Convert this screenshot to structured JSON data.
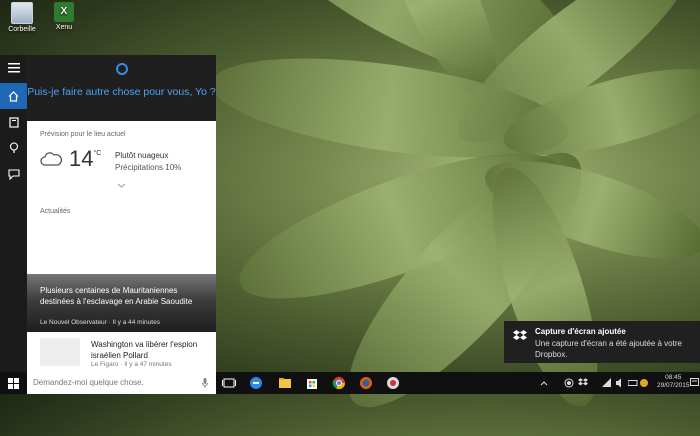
{
  "desktop": {
    "icons": [
      {
        "label": "Corbeille",
        "icon": "recycle-bin-icon"
      },
      {
        "label": "Xenu",
        "icon": "xenu-app-icon"
      }
    ]
  },
  "cortana": {
    "prompt": "Puis-je faire autre chose pour vous, Yo ?",
    "nav": [
      "hamburger-icon",
      "home-icon",
      "notebook-icon",
      "lightbulb-icon",
      "feedback-icon"
    ],
    "weather": {
      "label": "Prévision pour le lieu actuel",
      "temp": "14",
      "unit": "°C",
      "condition": "Plutôt nuageux",
      "precip": "Précipitations 10%"
    },
    "news": {
      "label": "Actualités",
      "items": [
        {
          "title": "Plusieurs centaines de Mauritaniennes destinées à l'esclavage en Arabie Saoudite",
          "source": "Le Nouvel Observateur · Il y a 44 minutes"
        },
        {
          "title": "Washington va libérer l'espion israélien Pollard",
          "source": "Le Figaro · Il y a 47 minutes"
        }
      ]
    }
  },
  "taskbar": {
    "search_placeholder": "Demandez-moi quelque chose.",
    "time": "08:45",
    "date": "29/07/2015",
    "apps": [
      "task-view-icon",
      "edge-icon",
      "file-explorer-icon",
      "store-icon",
      "chrome-icon",
      "firefox-icon",
      "snipping-icon"
    ]
  },
  "toast": {
    "title": "Capture d'écran ajoutée",
    "body": "Une capture d'écran a été ajoutée à votre Dropbox."
  },
  "colors": {
    "accent": "#1e68b6",
    "cortana_blue": "#4ea3f2"
  }
}
